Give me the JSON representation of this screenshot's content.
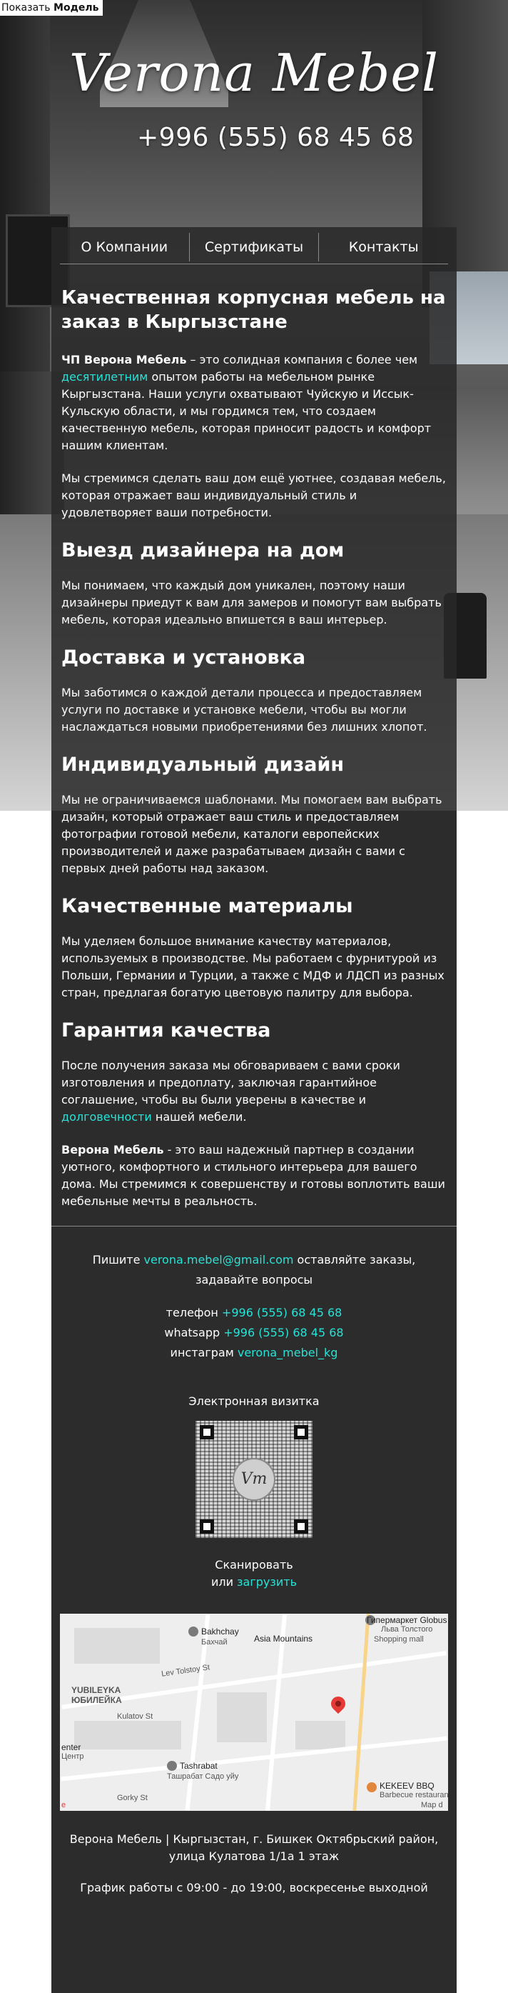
{
  "topbar": {
    "show_label": "Показать",
    "show_value": "Модель"
  },
  "header": {
    "logo": "Verona Mebel",
    "phone": "+996 (555) 68 45 68"
  },
  "nav": {
    "items": [
      {
        "label": "О Компании"
      },
      {
        "label": "Сертификаты"
      },
      {
        "label": "Контакты"
      }
    ]
  },
  "main": {
    "title": "Качественная корпусная мебель на заказ в Кыргызстане",
    "intro_brand": "ЧП Верона Мебель",
    "intro_a": " – это солидная компания с более чем ",
    "intro_link": "десятилетним",
    "intro_b": " опытом работы на мебельном рынке Кыргызстана. Наши услуги охватывают Чуйскую и Иссык-Кульскую области, и мы гордимся тем, что создаем качественную мебель, которая приносит радость и комфорт нашим клиентам.",
    "intro2": "Мы стремимся сделать ваш дом ещё уютнее, создавая мебель, которая отражает ваш индивидуальный стиль и удовлетворяет ваши потребности.",
    "s1_title": "Выезд дизайнера на дом",
    "s1_text": "Мы понимаем, что каждый дом уникален, поэтому наши дизайнеры приедут к вам для замеров и помогут вам выбрать мебель, которая идеально впишется в ваш интерьер.",
    "s2_title": "Доставка и установка",
    "s2_text": "Мы заботимся о каждой детали процесса и предоставляем услуги по доставке и установке мебели, чтобы вы могли наслаждаться новыми приобретениями без лишних хлопот.",
    "s3_title": "Индивидуальный дизайн",
    "s3_text": "Мы не ограничиваемся шаблонами. Мы помогаем вам выбрать дизайн, который отражает ваш стиль и предоставляем фотографии готовой мебели, каталоги европейских производителей и даже разрабатываем дизайн с вами с первых дней работы над заказом.",
    "s4_title": "Качественные материалы",
    "s4_text": "Мы уделяем большое внимание качеству материалов, используемых в производстве. Мы работаем с фурнитурой из Польши, Германии и Турции, а также с МДФ и ЛДСП из разных стран, предлагая богатую цветовую палитру для выбора.",
    "s5_title": "Гарантия качества",
    "s5_text_a": "После получения заказа мы обговариваем с вами сроки изготовления и предоплату, заключая гарантийное соглашение, чтобы вы были уверены в качестве и ",
    "s5_link": "долговечности",
    "s5_text_b": " нашей мебели.",
    "outro_brand": "Верона Мебель",
    "outro_text": " - это ваш надежный партнер в создании уютного, комфортного и стильного интерьера для вашего дома. Мы стремимся к совершенству и готовы воплотить ваши мебельные мечты в реальность."
  },
  "contacts": {
    "write_a": "Пишите ",
    "email": "verona.mebel@gmail.com",
    "write_b": " оставляйте заказы,",
    "write_c": "задавайте вопросы",
    "phone_label": "телефон ",
    "phone": "+996 (555) 68 45 68",
    "whatsapp_label": "whatsapp ",
    "whatsapp": "+996 (555) 68 45 68",
    "instagram_label": "инстаграм ",
    "instagram": "verona_mebel_kg",
    "qr_title": "Электронная визитка",
    "qr_monogram": "Vm",
    "scan_label": "Сканировать",
    "or_label": "или ",
    "download_link": "загрузить"
  },
  "map": {
    "labels": {
      "globus": "Гипермаркет Globus",
      "globus2": "Льва Толстого",
      "globus3": "Shopping mall",
      "bakhchay": "Bakhchay",
      "bakhchay2": "Бахчай",
      "asia": "Asia Mountains",
      "tolstoy": "Lev Tolstoy St",
      "yubileyka": "YUBILEYKA",
      "yubileyka2": "ЮБИЛЕЙКА",
      "kulatov": "Kulatov St",
      "enter": "enter",
      "enter2": "Центр",
      "tashrabat": "Tashrabat",
      "tashrabat2": "Ташрабат Садо уйу",
      "gorky": "Gorky St",
      "kekeev": "KEKEEV BBQ",
      "kekeev2": "Barbecue restaurant",
      "mapdata": "Map d",
      "e": "e"
    }
  },
  "footer": {
    "address": "Верона Мебель | Кыргызстан, г. Бишкек Октябрьский район, улица Кулатова 1/1а 1 этаж",
    "schedule": "График работы с 09:00 - до 19:00, воскресенье выходной"
  }
}
